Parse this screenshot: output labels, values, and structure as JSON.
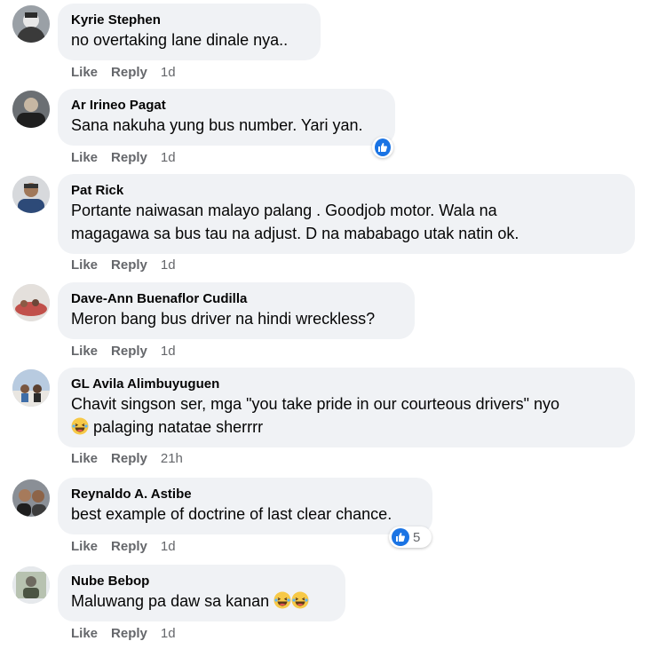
{
  "actions": {
    "like": "Like",
    "reply": "Reply"
  },
  "comments": [
    {
      "author": "Kyrie Stephen",
      "text": "no overtaking lane dinale nya..",
      "time": "1d"
    },
    {
      "author": "Ar Irineo Pagat",
      "text": "Sana nakuha yung bus number. Yari yan.",
      "time": "1d"
    },
    {
      "author": "Pat Rick",
      "line1": "Portante naiwasan malayo palang . Goodjob motor. Wala na",
      "line2": "magagawa sa bus tau na adjust. D na mababago utak natin ok.",
      "time": "1d"
    },
    {
      "author": "Dave-Ann Buenaflor Cudilla",
      "text": "Meron bang bus driver na hindi wreckless?",
      "time": "1d"
    },
    {
      "author": "GL Avila Alimbuyuguen",
      "line1": "Chavit singson ser, mga \"you take pride in our courteous drivers\" nyo",
      "line2": "palaging natatae sherrrr",
      "time": "21h"
    },
    {
      "author": "Reynaldo A. Astibe",
      "text": "best example of doctrine of last clear chance.",
      "time": "1d",
      "reactions": "5"
    },
    {
      "author": "Nube Bebop",
      "text": "Maluwang pa daw sa kanan",
      "time": "1d"
    }
  ],
  "colors": {
    "bubble": "#f0f2f5",
    "meta": "#65676b",
    "like_blue": "#1b74e4"
  }
}
